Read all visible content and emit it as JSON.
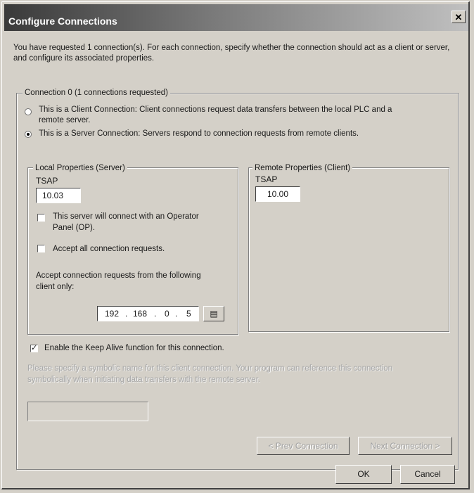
{
  "window": {
    "title": "Configure Connections",
    "close_glyph": "✕"
  },
  "intro": "You have requested 1 connection(s).  For each connection, specify whether the connection should act as a client or server, and configure its associated properties.",
  "connection_group": {
    "label": "Connection 0 (1 connections requested)",
    "client_option": {
      "selected": false,
      "label_line1": "This is a Client Connection: Client connections request data transfers between the local PLC and a",
      "label_line2": "remote server."
    },
    "server_option": {
      "selected": true,
      "label": "This is a Server Connection: Servers respond to connection requests from remote clients."
    }
  },
  "local_properties": {
    "label": "Local Properties (Server)",
    "tsap_label": "TSAP",
    "tsap_value": "10.03",
    "operator_panel": {
      "checked": false,
      "label_line1": "This server will connect with an Operator",
      "label_line2": "Panel (OP)."
    },
    "accept_all": {
      "checked": false,
      "label": "Accept all connection requests."
    },
    "client_only_label_line1": "Accept connection requests from the following",
    "client_only_label_line2": "client only:",
    "ip": [
      "192",
      "168",
      "0",
      "5"
    ],
    "ip_separator": ".",
    "address_book_icon": "address-book-icon",
    "address_book_glyph": "▤"
  },
  "remote_properties": {
    "label": "Remote Properties (Client)",
    "tsap_label": "TSAP",
    "tsap_value": "10.00"
  },
  "keep_alive": {
    "checked": true,
    "check_glyph": "✓",
    "label": "Enable the Keep Alive function for this connection."
  },
  "symbolic_name": {
    "instructions_line1": "Please specify a symbolic name for this client connection.  Your program can reference this connection",
    "instructions_line2": "symbolically when initiating data transfers with the remote server.",
    "value": ""
  },
  "buttons": {
    "prev": "< Prev Connection",
    "next": "Next Connection >",
    "ok": "OK",
    "cancel": "Cancel"
  }
}
